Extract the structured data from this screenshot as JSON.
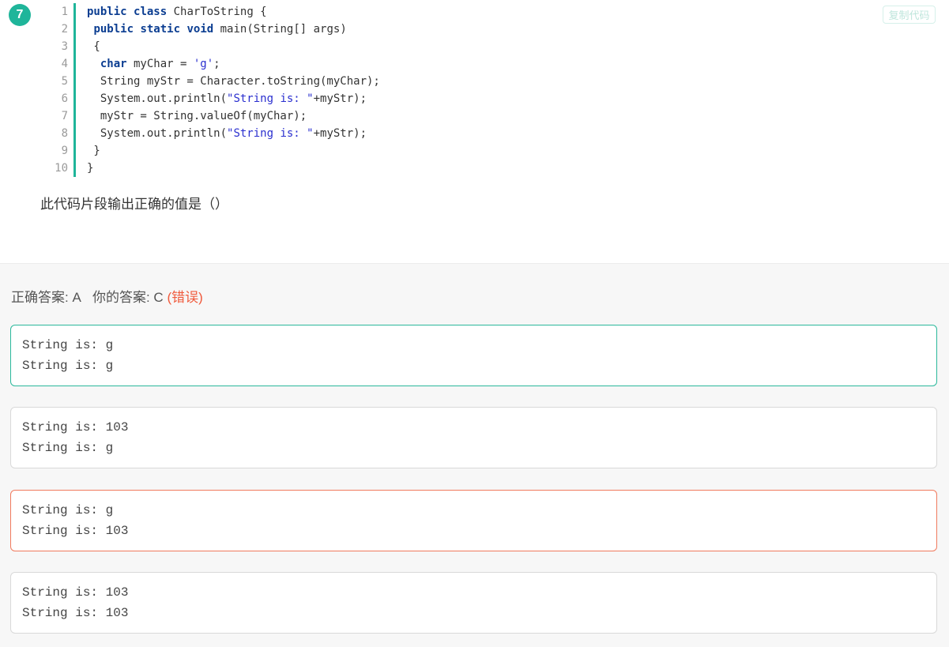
{
  "question": {
    "number": "7",
    "copy_label": "复制代码",
    "prompt": "此代码片段输出正确的值是（）"
  },
  "code_lines": [
    {
      "n": "1",
      "tokens": [
        {
          "t": "public",
          "c": "kw"
        },
        {
          "t": " "
        },
        {
          "t": "class",
          "c": "kw"
        },
        {
          "t": " CharToString {"
        }
      ]
    },
    {
      "n": "2",
      "tokens": [
        {
          "t": " "
        },
        {
          "t": "public",
          "c": "kw"
        },
        {
          "t": " "
        },
        {
          "t": "static",
          "c": "kw"
        },
        {
          "t": " "
        },
        {
          "t": "void",
          "c": "kw"
        },
        {
          "t": " main(String[] args)"
        }
      ]
    },
    {
      "n": "3",
      "tokens": [
        {
          "t": " {"
        }
      ]
    },
    {
      "n": "4",
      "tokens": [
        {
          "t": "  "
        },
        {
          "t": "char",
          "c": "kw"
        },
        {
          "t": " myChar = "
        },
        {
          "t": "'g'",
          "c": "str"
        },
        {
          "t": ";"
        }
      ]
    },
    {
      "n": "5",
      "tokens": [
        {
          "t": "  String myStr = Character.toString(myChar);"
        }
      ]
    },
    {
      "n": "6",
      "tokens": [
        {
          "t": "  System.out.println("
        },
        {
          "t": "\"String is: \"",
          "c": "str"
        },
        {
          "t": "+myStr);"
        }
      ]
    },
    {
      "n": "7",
      "tokens": [
        {
          "t": "  myStr = String.valueOf(myChar);"
        }
      ]
    },
    {
      "n": "8",
      "tokens": [
        {
          "t": "  System.out.println("
        },
        {
          "t": "\"String is: \"",
          "c": "str"
        },
        {
          "t": "+myStr);"
        }
      ]
    },
    {
      "n": "9",
      "tokens": [
        {
          "t": " }"
        }
      ]
    },
    {
      "n": "10",
      "tokens": [
        {
          "t": "}"
        }
      ]
    }
  ],
  "result": {
    "correct_label": "正确答案: A",
    "your_label": "你的答案: C",
    "verdict": "(错误)"
  },
  "options": [
    {
      "state": "correct",
      "lines": [
        "String is: g",
        "String is: g"
      ]
    },
    {
      "state": "normal",
      "lines": [
        "String is: 103",
        "String is: g"
      ]
    },
    {
      "state": "wrong",
      "lines": [
        "String is: g",
        "String is: 103"
      ]
    },
    {
      "state": "normal",
      "lines": [
        "String is: 103",
        "String is: 103"
      ]
    }
  ],
  "colors": {
    "accent": "#1fb59a",
    "wrong": "#f05a3c"
  }
}
